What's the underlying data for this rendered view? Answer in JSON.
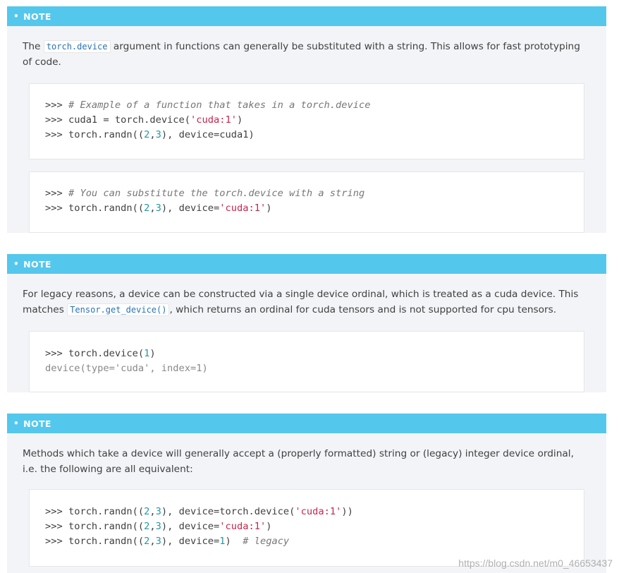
{
  "notes": [
    {
      "label": "NOTE",
      "text_before": "The ",
      "code": "torch.device",
      "text_after": " argument in functions can generally be substituted with a string. This allows for fast prototyping of code.",
      "blocks": [
        [
          {
            "prompt": ">>> ",
            "comment": "# Example of a function that takes in a torch.device"
          },
          {
            "prompt": ">>> ",
            "a": "cuda1 = torch.device(",
            "s": "'cuda:1'",
            "b": ")"
          },
          {
            "prompt": ">>> ",
            "a": "torch.randn((",
            "n1": "2",
            "c": ",",
            "n2": "3",
            "b": "), device=cuda1)"
          }
        ],
        [
          {
            "prompt": ">>> ",
            "comment": "# You can substitute the torch.device with a string"
          },
          {
            "prompt": ">>> ",
            "a": "torch.randn((",
            "n1": "2",
            "c": ",",
            "n2": "3",
            "b": "), device=",
            "s": "'cuda:1'",
            "d": ")"
          }
        ]
      ]
    },
    {
      "label": "NOTE",
      "text_before": "For legacy reasons, a device can be constructed via a single device ordinal, which is treated as a cuda device. This matches ",
      "code": "Tensor.get_device()",
      "text_after": ", which returns an ordinal for cuda tensors and is not supported for cpu tensors.",
      "blocks": [
        [
          {
            "prompt": ">>> ",
            "a": "torch.device(",
            "n1": "1",
            "b": ")"
          },
          {
            "output": "device(type='cuda', index=1)"
          }
        ]
      ]
    },
    {
      "label": "NOTE",
      "text": "Methods which take a device will generally accept a (properly formatted) string or (legacy) integer device ordinal, i.e. the following are all equivalent:",
      "blocks": [
        [
          {
            "prompt": ">>> ",
            "a": "torch.randn((",
            "n1": "2",
            "c": ",",
            "n2": "3",
            "b": "), device=torch.device(",
            "s": "'cuda:1'",
            "d": "))"
          },
          {
            "prompt": ">>> ",
            "a": "torch.randn((",
            "n1": "2",
            "c": ",",
            "n2": "3",
            "b": "), device=",
            "s": "'cuda:1'",
            "d": ")"
          },
          {
            "prompt": ">>> ",
            "a": "torch.randn((",
            "n1": "2",
            "c": ",",
            "n2": "3",
            "b": "), device=",
            "n3": "1",
            "d": ")  ",
            "comment": "# legacy"
          }
        ]
      ]
    }
  ],
  "watermark": "https://blog.csdn.net/m0_46653437"
}
